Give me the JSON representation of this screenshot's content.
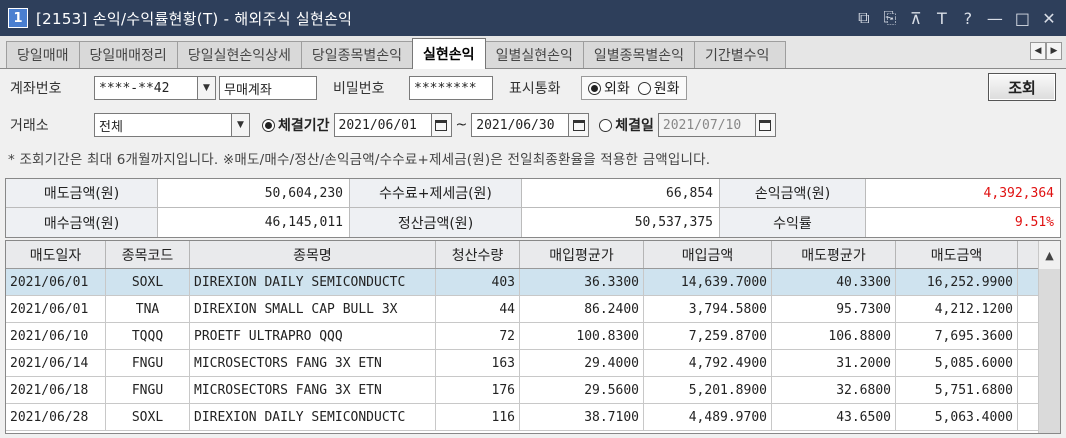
{
  "window": {
    "number": "1",
    "title": "[2153] 손익/수익률현황(T) - 해외주식 실현손익",
    "controls": [
      "⧉",
      "⎘",
      "⊼",
      "T",
      "?",
      "—",
      "□",
      "✕"
    ]
  },
  "tabs": [
    {
      "label": "당일매매"
    },
    {
      "label": "당일매매정리"
    },
    {
      "label": "당일실현손익상세"
    },
    {
      "label": "당일종목별손익"
    },
    {
      "label": "실현손익",
      "active": true
    },
    {
      "label": "일별실현손익"
    },
    {
      "label": "일별종목별손익"
    },
    {
      "label": "기간별수익"
    }
  ],
  "tab_nav": {
    "prev": "◀",
    "next": "▶"
  },
  "form": {
    "account_label": "계좌번호",
    "account_value": "****-**42",
    "account_name": "무매계좌",
    "password_label": "비밀번호",
    "password_value": "********",
    "currency_label": "표시통화",
    "currency_foreign": "외화",
    "currency_won": "원화",
    "exchange_label": "거래소",
    "exchange_value": "전체",
    "exec_period_label": "체결기간",
    "date_from": "2021/06/01",
    "tilde": "~",
    "date_to": "2021/06/30",
    "exec_day_label": "체결일",
    "exec_day_value": "2021/07/10",
    "query_button": "조회",
    "notice": "* 조회기간은 최대 6개월까지입니다.  ※매도/매수/정산/손익금액/수수료+제세금(원)은 전일최종환율을 적용한 금액입니다."
  },
  "summary": {
    "sell_amount_label": "매도금액(원)",
    "sell_amount": "50,604,230",
    "fee_tax_label": "수수료+제세금(원)",
    "fee_tax": "66,854",
    "pnl_label": "손익금액(원)",
    "pnl": "4,392,364",
    "buy_amount_label": "매수금액(원)",
    "buy_amount": "46,145,011",
    "settle_label": "정산금액(원)",
    "settle": "50,537,375",
    "return_label": "수익률",
    "return": "9.51%"
  },
  "grid": {
    "headers": [
      "매도일자",
      "종목코드",
      "종목명",
      "청산수량",
      "매입평균가",
      "매입금액",
      "매도평균가",
      "매도금액"
    ],
    "rows": [
      [
        "2021/06/01",
        "SOXL",
        "DIREXION DAILY SEMICONDUCTC",
        "403",
        "36.3300",
        "14,639.7000",
        "40.3300",
        "16,252.9900"
      ],
      [
        "2021/06/01",
        "TNA",
        "DIREXION SMALL CAP BULL 3X",
        "44",
        "86.2400",
        "3,794.5800",
        "95.7300",
        "4,212.1200"
      ],
      [
        "2021/06/10",
        "TQQQ",
        "PROETF ULTRAPRO QQQ",
        "72",
        "100.8300",
        "7,259.8700",
        "106.8800",
        "7,695.3600"
      ],
      [
        "2021/06/14",
        "FNGU",
        "MICROSECTORS FANG 3X ETN",
        "163",
        "29.4000",
        "4,792.4900",
        "31.2000",
        "5,085.6000"
      ],
      [
        "2021/06/18",
        "FNGU",
        "MICROSECTORS FANG 3X ETN",
        "176",
        "29.5600",
        "5,201.8900",
        "32.6800",
        "5,751.6800"
      ],
      [
        "2021/06/28",
        "SOXL",
        "DIREXION DAILY SEMICONDUCTC",
        "116",
        "38.7100",
        "4,489.9700",
        "43.6500",
        "5,063.4000"
      ]
    ],
    "selected_row": 0,
    "scroll_up": "▲"
  },
  "colors": {
    "titlebar": "#2e3f5b",
    "selected_row": "#cfe3ef",
    "positive": "#e01010"
  }
}
